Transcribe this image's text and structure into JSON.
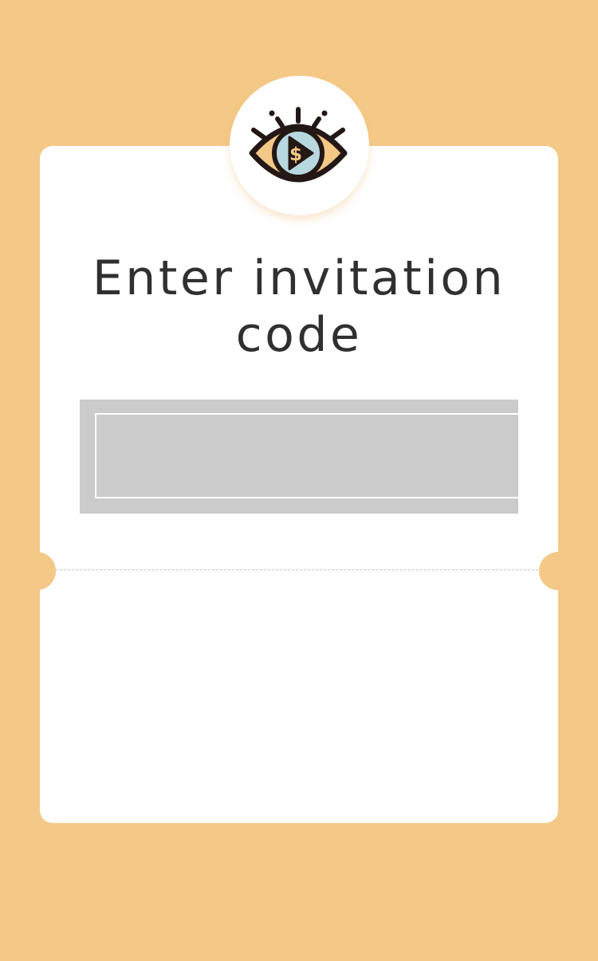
{
  "page": {
    "title": "Enter invitation code"
  },
  "logo": {
    "icon": "eye-play-dollar-icon",
    "symbol": "$"
  },
  "invite_input": {
    "value": "",
    "placeholder": ""
  },
  "colors": {
    "background": "#f4c886",
    "card": "#ffffff",
    "input_box": "#cbcbcb",
    "text": "#303030",
    "logo_dark": "#231815",
    "logo_iris": "#b8d8e0",
    "logo_accent": "#f4c886"
  }
}
